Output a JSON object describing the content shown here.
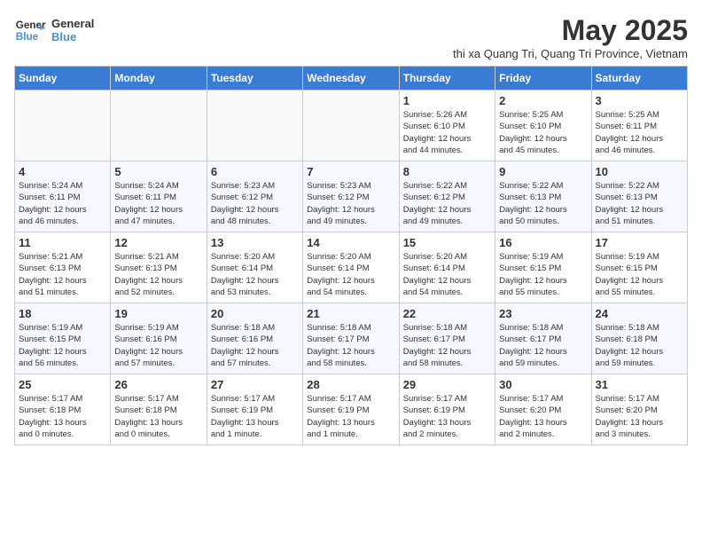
{
  "logo": {
    "text_general": "General",
    "text_blue": "Blue"
  },
  "title": "May 2025",
  "subtitle": "thi xa Quang Tri, Quang Tri Province, Vietnam",
  "days_of_week": [
    "Sunday",
    "Monday",
    "Tuesday",
    "Wednesday",
    "Thursday",
    "Friday",
    "Saturday"
  ],
  "weeks": [
    [
      {
        "day": "",
        "info": ""
      },
      {
        "day": "",
        "info": ""
      },
      {
        "day": "",
        "info": ""
      },
      {
        "day": "",
        "info": ""
      },
      {
        "day": "1",
        "info": "Sunrise: 5:26 AM\nSunset: 6:10 PM\nDaylight: 12 hours\nand 44 minutes."
      },
      {
        "day": "2",
        "info": "Sunrise: 5:25 AM\nSunset: 6:10 PM\nDaylight: 12 hours\nand 45 minutes."
      },
      {
        "day": "3",
        "info": "Sunrise: 5:25 AM\nSunset: 6:11 PM\nDaylight: 12 hours\nand 46 minutes."
      }
    ],
    [
      {
        "day": "4",
        "info": "Sunrise: 5:24 AM\nSunset: 6:11 PM\nDaylight: 12 hours\nand 46 minutes."
      },
      {
        "day": "5",
        "info": "Sunrise: 5:24 AM\nSunset: 6:11 PM\nDaylight: 12 hours\nand 47 minutes."
      },
      {
        "day": "6",
        "info": "Sunrise: 5:23 AM\nSunset: 6:12 PM\nDaylight: 12 hours\nand 48 minutes."
      },
      {
        "day": "7",
        "info": "Sunrise: 5:23 AM\nSunset: 6:12 PM\nDaylight: 12 hours\nand 49 minutes."
      },
      {
        "day": "8",
        "info": "Sunrise: 5:22 AM\nSunset: 6:12 PM\nDaylight: 12 hours\nand 49 minutes."
      },
      {
        "day": "9",
        "info": "Sunrise: 5:22 AM\nSunset: 6:13 PM\nDaylight: 12 hours\nand 50 minutes."
      },
      {
        "day": "10",
        "info": "Sunrise: 5:22 AM\nSunset: 6:13 PM\nDaylight: 12 hours\nand 51 minutes."
      }
    ],
    [
      {
        "day": "11",
        "info": "Sunrise: 5:21 AM\nSunset: 6:13 PM\nDaylight: 12 hours\nand 51 minutes."
      },
      {
        "day": "12",
        "info": "Sunrise: 5:21 AM\nSunset: 6:13 PM\nDaylight: 12 hours\nand 52 minutes."
      },
      {
        "day": "13",
        "info": "Sunrise: 5:20 AM\nSunset: 6:14 PM\nDaylight: 12 hours\nand 53 minutes."
      },
      {
        "day": "14",
        "info": "Sunrise: 5:20 AM\nSunset: 6:14 PM\nDaylight: 12 hours\nand 54 minutes."
      },
      {
        "day": "15",
        "info": "Sunrise: 5:20 AM\nSunset: 6:14 PM\nDaylight: 12 hours\nand 54 minutes."
      },
      {
        "day": "16",
        "info": "Sunrise: 5:19 AM\nSunset: 6:15 PM\nDaylight: 12 hours\nand 55 minutes."
      },
      {
        "day": "17",
        "info": "Sunrise: 5:19 AM\nSunset: 6:15 PM\nDaylight: 12 hours\nand 55 minutes."
      }
    ],
    [
      {
        "day": "18",
        "info": "Sunrise: 5:19 AM\nSunset: 6:15 PM\nDaylight: 12 hours\nand 56 minutes."
      },
      {
        "day": "19",
        "info": "Sunrise: 5:19 AM\nSunset: 6:16 PM\nDaylight: 12 hours\nand 57 minutes."
      },
      {
        "day": "20",
        "info": "Sunrise: 5:18 AM\nSunset: 6:16 PM\nDaylight: 12 hours\nand 57 minutes."
      },
      {
        "day": "21",
        "info": "Sunrise: 5:18 AM\nSunset: 6:17 PM\nDaylight: 12 hours\nand 58 minutes."
      },
      {
        "day": "22",
        "info": "Sunrise: 5:18 AM\nSunset: 6:17 PM\nDaylight: 12 hours\nand 58 minutes."
      },
      {
        "day": "23",
        "info": "Sunrise: 5:18 AM\nSunset: 6:17 PM\nDaylight: 12 hours\nand 59 minutes."
      },
      {
        "day": "24",
        "info": "Sunrise: 5:18 AM\nSunset: 6:18 PM\nDaylight: 12 hours\nand 59 minutes."
      }
    ],
    [
      {
        "day": "25",
        "info": "Sunrise: 5:17 AM\nSunset: 6:18 PM\nDaylight: 13 hours\nand 0 minutes."
      },
      {
        "day": "26",
        "info": "Sunrise: 5:17 AM\nSunset: 6:18 PM\nDaylight: 13 hours\nand 0 minutes."
      },
      {
        "day": "27",
        "info": "Sunrise: 5:17 AM\nSunset: 6:19 PM\nDaylight: 13 hours\nand 1 minute."
      },
      {
        "day": "28",
        "info": "Sunrise: 5:17 AM\nSunset: 6:19 PM\nDaylight: 13 hours\nand 1 minute."
      },
      {
        "day": "29",
        "info": "Sunrise: 5:17 AM\nSunset: 6:19 PM\nDaylight: 13 hours\nand 2 minutes."
      },
      {
        "day": "30",
        "info": "Sunrise: 5:17 AM\nSunset: 6:20 PM\nDaylight: 13 hours\nand 2 minutes."
      },
      {
        "day": "31",
        "info": "Sunrise: 5:17 AM\nSunset: 6:20 PM\nDaylight: 13 hours\nand 3 minutes."
      }
    ]
  ]
}
